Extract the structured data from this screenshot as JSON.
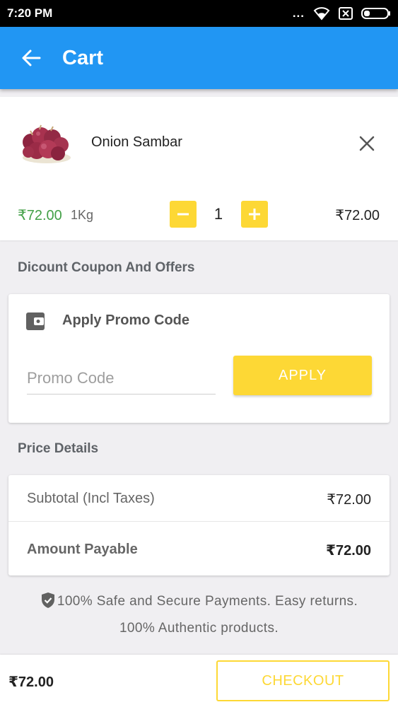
{
  "status_bar": {
    "time": "7:20 PM",
    "dots": "...",
    "icons": [
      "wifi-icon",
      "sim-icon",
      "battery-icon"
    ]
  },
  "app_bar": {
    "title": "Cart",
    "back_icon": "arrow-back-icon",
    "color": "#2196f3"
  },
  "cart": {
    "items": [
      {
        "name": "Onion Sambar",
        "price": "₹72.00",
        "weight": "1Kg",
        "quantity": "1",
        "total": "₹72.00",
        "image_icon": "onion-image",
        "remove_icon": "close-icon"
      }
    ]
  },
  "coupon": {
    "section_title": "Dicount Coupon And Offers",
    "heading": "Apply Promo Code",
    "icon": "wallet-icon",
    "input_placeholder": "Promo Code",
    "input_value": "",
    "apply_label": "APPLY"
  },
  "price_details": {
    "section_title": "Price Details",
    "subtotal_label": "Subtotal (Incl Taxes)",
    "subtotal_value": "₹72.00",
    "payable_label": "Amount Payable",
    "payable_value": "₹72.00"
  },
  "secure": {
    "icon": "shield-check-icon",
    "line1": "100% Safe and Secure Payments. Easy returns.",
    "line2": "100% Authentic products."
  },
  "bottom_bar": {
    "total": "₹72.00",
    "checkout_label": "CHECKOUT"
  },
  "colors": {
    "primary": "#2196f3",
    "accent": "#fdd835",
    "price_green": "#43a047"
  }
}
